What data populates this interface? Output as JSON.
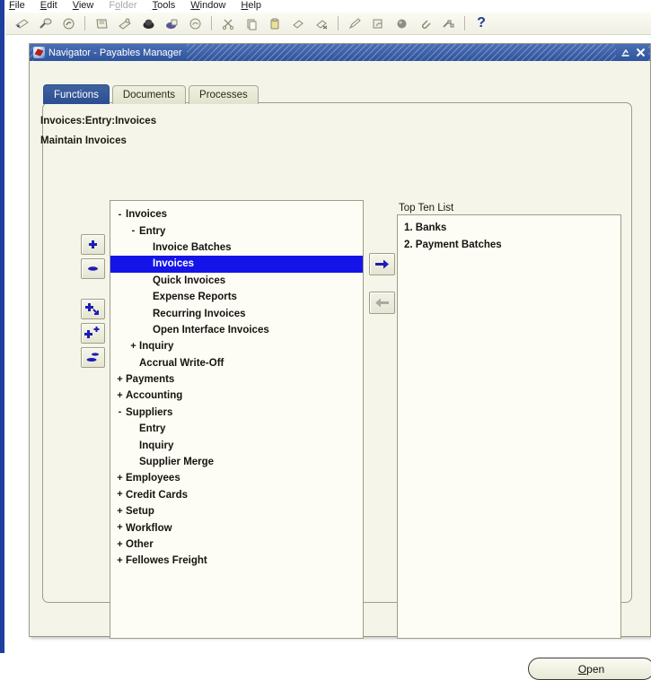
{
  "menubar": {
    "items": [
      {
        "label": "File",
        "mnemonic": "F",
        "disabled": false
      },
      {
        "label": "Edit",
        "mnemonic": "E",
        "disabled": false
      },
      {
        "label": "View",
        "mnemonic": "V",
        "disabled": false
      },
      {
        "label": "Folder",
        "mnemonic": "o",
        "disabled": true
      },
      {
        "label": "Tools",
        "mnemonic": "T",
        "disabled": false
      },
      {
        "label": "Window",
        "mnemonic": "W",
        "disabled": false
      },
      {
        "label": "Help",
        "mnemonic": "H",
        "disabled": false
      }
    ]
  },
  "toolbar": {
    "buttons": [
      {
        "name": "new-icon"
      },
      {
        "name": "find-icon"
      },
      {
        "name": "show-navigator-icon"
      },
      {
        "name": "separator"
      },
      {
        "name": "save-icon"
      },
      {
        "name": "save-and-proceed-icon"
      },
      {
        "name": "next-step-icon"
      },
      {
        "name": "print-icon"
      },
      {
        "name": "close-form-icon"
      },
      {
        "name": "separator"
      },
      {
        "name": "cut-icon"
      },
      {
        "name": "copy-icon"
      },
      {
        "name": "paste-icon"
      },
      {
        "name": "clear-record-icon"
      },
      {
        "name": "delete-record-icon"
      },
      {
        "name": "separator"
      },
      {
        "name": "edit-field-icon"
      },
      {
        "name": "zoom-icon"
      },
      {
        "name": "translations-icon"
      },
      {
        "name": "attachments-icon"
      },
      {
        "name": "folder-tools-icon"
      },
      {
        "name": "separator"
      },
      {
        "name": "help-icon",
        "label": "?"
      }
    ]
  },
  "window": {
    "title": "Navigator - Payables Manager",
    "icon": "oracle-app-icon",
    "buttons": [
      {
        "name": "minimize-button",
        "glyph": "minimize"
      },
      {
        "name": "close-button",
        "glyph": "close"
      }
    ]
  },
  "tabs": [
    {
      "label": "Functions",
      "active": true
    },
    {
      "label": "Documents",
      "active": false
    },
    {
      "label": "Processes",
      "active": false
    }
  ],
  "page": {
    "breadcrumb": "Invoices:Entry:Invoices",
    "subtitle": "Maintain Invoices"
  },
  "tree_tools": [
    {
      "name": "expand-node-button",
      "glyph": "plus"
    },
    {
      "name": "collapse-node-button",
      "glyph": "minus"
    },
    {
      "name": "expand-branch-button",
      "glyph": "plus-arrow"
    },
    {
      "name": "expand-all-button",
      "glyph": "plus-plus"
    },
    {
      "name": "collapse-all-button",
      "glyph": "minus-minus"
    }
  ],
  "transfer": [
    {
      "name": "add-to-top-ten-button",
      "glyph": "arrow-right",
      "enabled": true
    },
    {
      "name": "remove-from-top-ten-button",
      "glyph": "arrow-left",
      "enabled": false
    }
  ],
  "tree": {
    "nodes": [
      {
        "label": "Invoices",
        "indent": 0,
        "toggle": "-",
        "selected": false
      },
      {
        "label": "Entry",
        "indent": 1,
        "toggle": "-",
        "selected": false
      },
      {
        "label": "Invoice Batches",
        "indent": 2,
        "toggle": "",
        "selected": false
      },
      {
        "label": "Invoices",
        "indent": 2,
        "toggle": "",
        "selected": true
      },
      {
        "label": "Quick Invoices",
        "indent": 2,
        "toggle": "",
        "selected": false
      },
      {
        "label": "Expense Reports",
        "indent": 2,
        "toggle": "",
        "selected": false
      },
      {
        "label": "Recurring Invoices",
        "indent": 2,
        "toggle": "",
        "selected": false
      },
      {
        "label": "Open Interface Invoices",
        "indent": 2,
        "toggle": "",
        "selected": false
      },
      {
        "label": "Inquiry",
        "indent": 1,
        "toggle": "+",
        "selected": false
      },
      {
        "label": "Accrual Write-Off",
        "indent": 1,
        "toggle": "",
        "selected": false
      },
      {
        "label": "Payments",
        "indent": 0,
        "toggle": "+",
        "selected": false
      },
      {
        "label": "Accounting",
        "indent": 0,
        "toggle": "+",
        "selected": false
      },
      {
        "label": "Suppliers",
        "indent": 0,
        "toggle": "-",
        "selected": false
      },
      {
        "label": "Entry",
        "indent": 1,
        "toggle": "",
        "selected": false
      },
      {
        "label": "Inquiry",
        "indent": 1,
        "toggle": "",
        "selected": false
      },
      {
        "label": "Supplier Merge",
        "indent": 1,
        "toggle": "",
        "selected": false
      },
      {
        "label": "Employees",
        "indent": 0,
        "toggle": "+",
        "selected": false
      },
      {
        "label": "Credit Cards",
        "indent": 0,
        "toggle": "+",
        "selected": false
      },
      {
        "label": "Setup",
        "indent": 0,
        "toggle": "+",
        "selected": false
      },
      {
        "label": "Workflow",
        "indent": 0,
        "toggle": "+",
        "selected": false
      },
      {
        "label": "Other",
        "indent": 0,
        "toggle": "+",
        "selected": false
      },
      {
        "label": "Fellowes Freight",
        "indent": 0,
        "toggle": "+",
        "selected": false
      }
    ]
  },
  "top_ten": {
    "label": "Top Ten List",
    "items": [
      {
        "text": "1. Banks"
      },
      {
        "text": "2. Payment Batches"
      }
    ]
  },
  "footer": {
    "open_label": "Open",
    "open_mnemonic": "O"
  },
  "colors": {
    "title_bar": "#2f549c",
    "active_tab": "#2c4e92",
    "selection": "#1414e8",
    "panel_bg": "#f4f4e9",
    "list_bg": "#fdfdf5",
    "accent_left_strip": "#1f3f9e"
  }
}
